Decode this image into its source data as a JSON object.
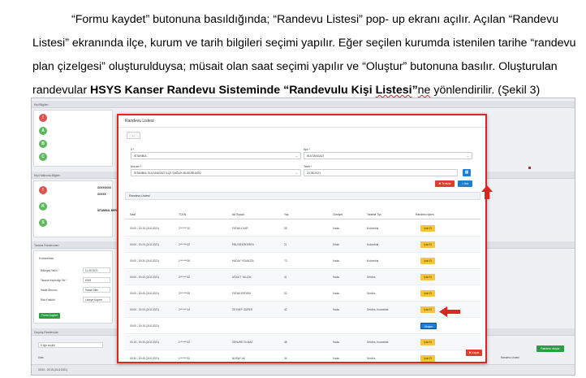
{
  "paragraph": {
    "line1": "“Formu kaydet” butonuna basıldığında; “Randevu Listesi” pop- up ekranı açılır. Açılan “Randevu",
    "line2": "Listesi” ekranında ilçe, kurum ve tarih bilgileri seçimi yapılır. Eğer seçilen kurumda istenilen tarihe “randevu",
    "line3": "plan çizelgesi” oluşturulduysa; müsait olan saat seçimi yapılır ve “Oluştur” butonuna basılır. Oluşturulan",
    "line4_pre": "randevular ",
    "line4_bold1": "HSYS Kanser Randevu Sisteminde “Randevulu Kişi ",
    "line4_bold_squig": "Listesi",
    "line4_bold2": "”",
    "line4_squig": "ne",
    "line4_post": " yönlendirilir. (Şekil 3)"
  },
  "background": {
    "strip1": "Kişi Bilgileri",
    "strip2": "Kişi Hakkında Bilgiler",
    "strip3": "Tarama Randevuları",
    "strip4": "Geçmiş Randevular",
    "circles": [
      "!",
      "A",
      "B",
      "C"
    ],
    "circles2": [
      "!",
      "K",
      "S"
    ],
    "circle_colors": [
      "#d9534f",
      "#5cb85c",
      "#5cb85c",
      "#5cb85c"
    ],
    "id_value": "XXXXXXXX",
    "name_value": "XXXXX",
    "org_value": "İSTANBUL MERKEZ",
    "section_label": "Kolorektal",
    "form_labels": [
      "Bildirgeç Tarihi *",
      "Tarama Yaptırdığı Yer *",
      "Hasta Durumu",
      "Risk Faktörü"
    ],
    "form_values": [
      "11.08.2021",
      "KHM",
      "Hasta Olan",
      "Listeye Kaydet"
    ],
    "save_button": "Formu kaydet",
    "select_value": "5 öğe seçildi",
    "date_col": "Date",
    "bottom_date": "00:00 - 00:15 (24.8.2021)",
    "bottom_right": "Randevu Listesi",
    "green_button": "Randevu oluştur"
  },
  "modal": {
    "title": "Randevu Listesi",
    "back": "←",
    "il_label": "İl *",
    "il_value": "İSTANBUL",
    "ilce_label": "İlçe *",
    "ilce_value": "SULTANGAZİ",
    "kurum_label": "Kurum *",
    "kurum_value": "İSTANBUL SULTANGAZİ İLÇE SAĞLIK MÜDÜRLÜĞÜ",
    "tarih_label": "Tarih *",
    "tarih_value": "24.08.2021",
    "temizle": "Temizle",
    "ara": "Ara",
    "list_header": "Randevu Listesi",
    "columns": [
      "Saat",
      "TCKN",
      "Ad Soyad",
      "Yaş",
      "Cinsiyet",
      "Tarama Tipi",
      "Randevu İşlem"
    ],
    "rows": [
      [
        "00:00 - 00:15 (24.8.2021)",
        "2*******10",
        "FATMA UYAR",
        "58",
        "Kadın",
        "Kolorektal",
        "İptal Et"
      ],
      [
        "00:00 - 00:20 (24.8.2021)",
        "2*******02",
        "EBU BEKİR EREN",
        "21",
        "Erkek",
        "Kolorektal",
        "İptal Et"
      ],
      [
        "00:00 - 00:30 (24.8.2021)",
        "1*******06",
        "HADAY YILMAZOL",
        "73",
        "Kadın",
        "Kolorektal",
        "İptal Et"
      ],
      [
        "00:00 - 00:40 (24.8.2021)",
        "3*******32",
        "AĞALIT YALÇIN",
        "41",
        "Kadın",
        "Serviks",
        "İptal Et"
      ],
      [
        "00:00 - 00:45 (24.8.2021)",
        "3*******08",
        "FATMA ERDEM",
        "52",
        "Kadın",
        "Serviks",
        "İptal Et"
      ],
      [
        "00:00 - 01:00 (24.8.2021)",
        "2*******14",
        "ZEYNEP GÜRER",
        "42",
        "Kadın",
        "Serviks, Kolorektal",
        "İptal Et"
      ],
      [
        "00:00 - 00:15 (24.8.2021)",
        "",
        "",
        "",
        "",
        "",
        "Oluştur"
      ],
      [
        "00:15 - 00:30 (24.8.2021)",
        "1*******22",
        "ZEHURE YILMAZ",
        "48",
        "Kadın",
        "Serviks, Kolorektal",
        "İptal Et"
      ],
      [
        "00:30 - 00:45 (24.8.2021)",
        "1*******32",
        "NURAY AK",
        "34",
        "Kadın",
        "Serviks",
        "İptal Et"
      ]
    ],
    "close": "Kapat"
  },
  "colors": {
    "frame": "#e52222",
    "primary": "#1c7fd6",
    "warn": "#f6c343",
    "danger": "#e03c31",
    "arrow": "#e52222"
  }
}
